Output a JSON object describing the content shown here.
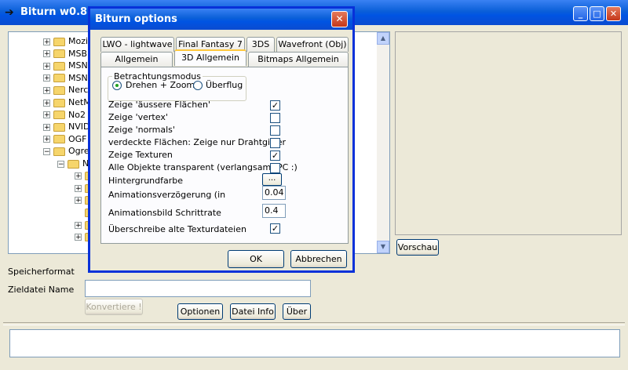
{
  "main_window": {
    "title": "Biturn w0.88",
    "controls": {
      "minimize": "_",
      "maximize": "□",
      "close": "✕"
    }
  },
  "tree": {
    "items": [
      {
        "label": "Mozi",
        "expander": "+",
        "level": 0
      },
      {
        "label": "MSB",
        "expander": "+",
        "level": 0
      },
      {
        "label": "MSN",
        "expander": "+",
        "level": 0
      },
      {
        "label": "MSN",
        "expander": "+",
        "level": 0
      },
      {
        "label": "Nerc",
        "expander": "+",
        "level": 0
      },
      {
        "label": "NetM",
        "expander": "+",
        "level": 0
      },
      {
        "label": "No2",
        "expander": "+",
        "level": 0
      },
      {
        "label": "NVID",
        "expander": "+",
        "level": 0
      },
      {
        "label": "OGF",
        "expander": "+",
        "level": 0
      },
      {
        "label": "Ogre",
        "expander": "−",
        "level": 0
      },
      {
        "label": "N",
        "expander": "−",
        "level": 1
      },
      {
        "label": "",
        "expander": "+",
        "level": 2
      },
      {
        "label": "",
        "expander": "+",
        "level": 2
      },
      {
        "label": "",
        "expander": "+",
        "level": 2
      },
      {
        "label": "",
        "expander": "",
        "level": 2
      },
      {
        "label": "",
        "expander": "+",
        "level": 2
      },
      {
        "label": "",
        "expander": "+",
        "level": 2
      }
    ],
    "scroll_up": "▲",
    "scroll_down": "▼"
  },
  "buttons": {
    "preview": "Vorschau",
    "convert": "Konvertiere !",
    "options": "Optionen",
    "file_info": "Datei Info",
    "about": "Über"
  },
  "form": {
    "save_format_label": "Speicherformat",
    "target_file_label": "Zieldatei Name",
    "target_file_value": ""
  },
  "dialog": {
    "title": "Biturn options",
    "close": "✕",
    "tabs_row1": [
      "LWO - lightwave",
      "Final Fantasy 7",
      "3DS",
      "Wavefront (Obj)"
    ],
    "tabs_row2": [
      "Allgemein",
      "3D Allgemein",
      "Bitmaps Allgemein"
    ],
    "active_tab": "3D Allgemein",
    "view_mode": {
      "legend": "Betrachtungsmodus",
      "options": [
        "Drehen + Zoom",
        "Überflug"
      ],
      "selected": "Drehen + Zoom"
    },
    "options": [
      {
        "label": "Zeige 'äussere Flächen'",
        "checked": true
      },
      {
        "label": "Zeige 'vertex'",
        "checked": false
      },
      {
        "label": "Zeige 'normals'",
        "checked": false
      },
      {
        "label": "verdeckte Flächen: Zeige nur Drahtgitter",
        "checked": false
      },
      {
        "label": "Zeige Texturen",
        "checked": true
      },
      {
        "label": "Alle Objekte transparent (verlangsamt PC :)",
        "checked": false
      }
    ],
    "background_color_label": "Hintergrundfarbe",
    "background_color_button": "...",
    "anim_delay_label": "Animationsverzögerung (in",
    "anim_delay_value": "0.04",
    "anim_step_label": "Animationsbild Schrittrate",
    "anim_step_value": "0.4",
    "overwrite_label": "Überschreibe alte Texturdateien",
    "overwrite_checked": true,
    "ok": "OK",
    "cancel": "Abbrechen"
  }
}
